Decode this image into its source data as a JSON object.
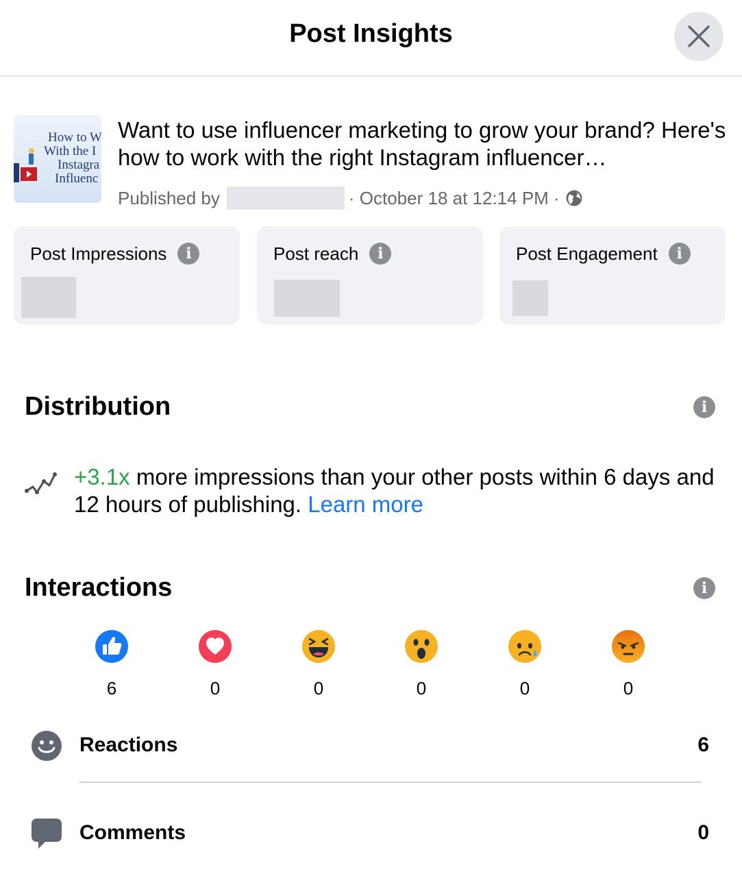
{
  "header": {
    "title": "Post Insights"
  },
  "post": {
    "text": "Want to use influencer marketing to grow your brand? Here's how to work with the right Instagram influencer…",
    "published_by_label": "Published by",
    "meta_rest": "· October 18 at 12:14 PM ·",
    "thumbnail_text": [
      "How to W",
      "With the I",
      "Instagra",
      "Influenc"
    ]
  },
  "metrics": [
    {
      "label": "Post Impressions"
    },
    {
      "label": "Post reach"
    },
    {
      "label": "Post Engagement"
    }
  ],
  "distribution": {
    "title": "Distribution",
    "highlight": "+3.1x",
    "text": " more impressions than your other posts within 6 days and 12 hours of publishing. ",
    "link": "Learn more"
  },
  "interactions": {
    "title": "Interactions",
    "reactions": [
      {
        "icon": "like-icon",
        "count": "6"
      },
      {
        "icon": "love-icon",
        "count": "0"
      },
      {
        "icon": "haha-icon",
        "count": "0"
      },
      {
        "icon": "wow-icon",
        "count": "0"
      },
      {
        "icon": "sad-icon",
        "count": "0"
      },
      {
        "icon": "angry-icon",
        "count": "0"
      }
    ],
    "rows": [
      {
        "icon": "smiley-icon",
        "label": "Reactions",
        "count": "6"
      },
      {
        "icon": "comment-icon",
        "label": "Comments",
        "count": "0"
      }
    ]
  },
  "colors": {
    "accent_blue": "#1877f2",
    "accent_green": "#31a24c",
    "card_bg": "#f0f2f5",
    "secondary_text": "#65676b"
  }
}
